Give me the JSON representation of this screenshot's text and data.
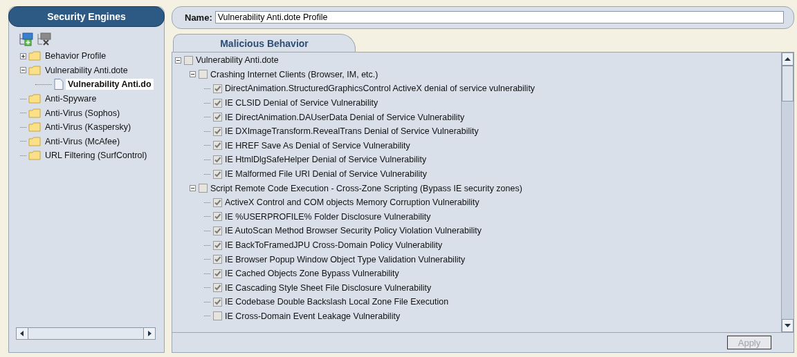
{
  "sidebar": {
    "title": "Security Engines",
    "tree": [
      {
        "label": "Behavior Profile",
        "kind": "folder",
        "expanded": false,
        "selected": false
      },
      {
        "label": "Vulnerability Anti.dote",
        "kind": "folder",
        "expanded": true,
        "selected": false,
        "children": [
          {
            "label": "Vulnerability Anti.do",
            "kind": "file",
            "selected": true
          }
        ]
      },
      {
        "label": "Anti-Spyware",
        "kind": "folder",
        "selected": false
      },
      {
        "label": "Anti-Virus (Sophos)",
        "kind": "folder",
        "selected": false
      },
      {
        "label": "Anti-Virus (Kaspersky)",
        "kind": "folder",
        "selected": false
      },
      {
        "label": "Anti-Virus (McAfee)",
        "kind": "folder",
        "selected": false
      },
      {
        "label": "URL Filtering (SurfControl)",
        "kind": "folder",
        "selected": false
      }
    ]
  },
  "name_field": {
    "label": "Name:",
    "value": "Vulnerability Anti.dote Profile"
  },
  "tabs": [
    {
      "label": "Malicious Behavior",
      "selected": true
    }
  ],
  "rules": [
    {
      "label": "Vulnerability Anti.dote",
      "checked": false,
      "expanded": true,
      "children": [
        {
          "label": "Crashing Internet Clients (Browser, IM, etc.)",
          "checked": false,
          "expanded": true,
          "children": [
            {
              "label": "DirectAnimation.StructuredGraphicsControl ActiveX denial of service vulnerability",
              "checked": true
            },
            {
              "label": "IE CLSID Denial of Service Vulnerability",
              "checked": true
            },
            {
              "label": "IE DirectAnimation.DAUserData Denial of Service Vulnerability",
              "checked": true
            },
            {
              "label": "IE DXImageTransform.RevealTrans Denial of Service Vulnerability",
              "checked": true
            },
            {
              "label": "IE HREF Save As Denial of Service Vulnerability",
              "checked": true
            },
            {
              "label": "IE HtmlDlgSafeHelper Denial of Service Vulnerability",
              "checked": true
            },
            {
              "label": "IE Malformed File URI Denial of Service Vulnerability",
              "checked": true
            }
          ]
        },
        {
          "label": "Script Remote Code Execution - Cross-Zone Scripting (Bypass IE security zones)",
          "checked": false,
          "expanded": true,
          "children": [
            {
              "label": "ActiveX Control and COM objects Memory Corruption Vulnerability",
              "checked": true
            },
            {
              "label": "IE %USERPROFILE% Folder Disclosure Vulnerability",
              "checked": true
            },
            {
              "label": "IE AutoScan Method Browser Security Policy Violation Vulnerability",
              "checked": true
            },
            {
              "label": "IE BackToFramedJPU Cross-Domain Policy Vulnerability",
              "checked": true
            },
            {
              "label": "IE Browser Popup Window Object Type Validation Vulnerability",
              "checked": true
            },
            {
              "label": "IE Cached Objects Zone Bypass Vulnerability",
              "checked": true
            },
            {
              "label": "IE Cascading Style Sheet File Disclosure Vulnerability",
              "checked": true
            },
            {
              "label": "IE Codebase Double Backslash Local Zone File Execution",
              "checked": true
            },
            {
              "label": "IE Cross-Domain Event Leakage Vulnerability",
              "checked": false
            }
          ]
        }
      ]
    }
  ],
  "apply_button": {
    "label": "Apply",
    "disabled": true
  }
}
